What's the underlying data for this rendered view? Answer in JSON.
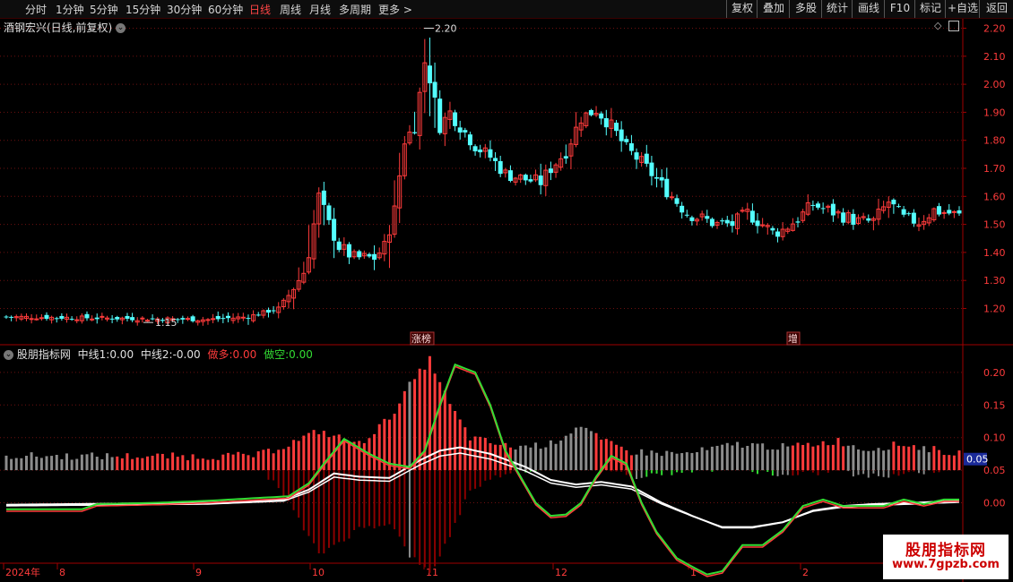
{
  "toolbar": {
    "periods": [
      "分时",
      "1分钟",
      "5分钟",
      "15分钟",
      "30分钟",
      "60分钟",
      "日线",
      "周线",
      "月线",
      "多周期",
      "更多"
    ],
    "active_period": "日线",
    "more_arrow": ">",
    "right_buttons": [
      "复权",
      "叠加",
      "多股",
      "统计",
      "画线",
      "F10",
      "标记",
      "+自选",
      "返回"
    ]
  },
  "main_panel": {
    "title": "酒钢宏兴(日线,前复权)",
    "max_label": "2.20",
    "min_label": "1.15",
    "events": [
      "涨榜",
      "增"
    ]
  },
  "indicator_panel": {
    "name": "股朋指标网",
    "mid1_label": "中线1:",
    "mid1_value": "0.00",
    "mid2_label": "中线2:",
    "mid2_value": "-0.00",
    "long_label": "做多:",
    "long_value": "0.00",
    "short_label": "做空:",
    "short_value": "0.00",
    "current_value": "0.05"
  },
  "price_axis": [
    "2.20",
    "2.10",
    "2.00",
    "1.90",
    "1.80",
    "1.70",
    "1.60",
    "1.50",
    "1.40",
    "1.30",
    "1.20"
  ],
  "indicator_axis": [
    "0.20",
    "0.15",
    "0.10",
    "0.05",
    "0.00"
  ],
  "time_axis": [
    "2024年",
    "8",
    "9",
    "10",
    "11",
    "12",
    "1",
    "2"
  ],
  "watermark": {
    "title": "股朋指标网",
    "url": "www.7gpzb.com"
  },
  "colors": {
    "up": "#ff3b3b",
    "down": "#54ffff",
    "white": "#ffffff",
    "green": "#33dd33",
    "gray": "#8c8c8c",
    "darkred": "#8b0000",
    "grid": "#6e1010"
  },
  "chart_data": {
    "type": "candlestick",
    "ylim": [
      1.12,
      2.25
    ],
    "price_waypoints": [
      [
        0,
        1.17
      ],
      [
        40,
        1.16
      ],
      [
        48,
        1.17
      ],
      [
        50,
        1.18
      ],
      [
        54,
        1.2
      ],
      [
        57,
        1.27
      ],
      [
        59,
        1.33
      ],
      [
        60,
        1.4
      ],
      [
        62,
        1.6
      ],
      [
        64,
        1.5
      ],
      [
        66,
        1.42
      ],
      [
        69,
        1.38
      ],
      [
        73,
        1.38
      ],
      [
        75,
        1.42
      ],
      [
        77,
        1.55
      ],
      [
        79,
        1.8
      ],
      [
        81,
        1.85
      ],
      [
        83,
        2.08
      ],
      [
        84,
        2.02
      ],
      [
        86,
        1.85
      ],
      [
        88,
        1.9
      ],
      [
        90,
        1.85
      ],
      [
        93,
        1.78
      ],
      [
        96,
        1.74
      ],
      [
        99,
        1.68
      ],
      [
        103,
        1.66
      ],
      [
        106,
        1.65
      ],
      [
        108,
        1.7
      ],
      [
        111,
        1.76
      ],
      [
        114,
        1.88
      ],
      [
        117,
        1.91
      ],
      [
        120,
        1.85
      ],
      [
        123,
        1.77
      ],
      [
        126,
        1.72
      ],
      [
        129,
        1.66
      ],
      [
        132,
        1.6
      ],
      [
        135,
        1.54
      ],
      [
        138,
        1.52
      ],
      [
        141,
        1.5
      ],
      [
        144,
        1.5
      ],
      [
        147,
        1.54
      ],
      [
        150,
        1.5
      ],
      [
        152,
        1.47
      ],
      [
        154,
        1.48
      ],
      [
        157,
        1.52
      ],
      [
        160,
        1.57
      ],
      [
        163,
        1.55
      ],
      [
        166,
        1.53
      ],
      [
        169,
        1.51
      ],
      [
        172,
        1.51
      ],
      [
        175,
        1.58
      ],
      [
        178,
        1.52
      ],
      [
        181,
        1.51
      ],
      [
        184,
        1.55
      ],
      [
        187,
        1.54
      ],
      [
        189,
        1.53
      ]
    ],
    "white_line": [
      [
        0,
        -0.003
      ],
      [
        40,
        0.0
      ],
      [
        55,
        0.005
      ],
      [
        60,
        0.02
      ],
      [
        65,
        0.045
      ],
      [
        70,
        0.04
      ],
      [
        76,
        0.038
      ],
      [
        82,
        0.065
      ],
      [
        86,
        0.08
      ],
      [
        90,
        0.085
      ],
      [
        96,
        0.075
      ],
      [
        103,
        0.055
      ],
      [
        108,
        0.035
      ],
      [
        113,
        0.028
      ],
      [
        118,
        0.032
      ],
      [
        124,
        0.025
      ],
      [
        130,
        0.0
      ],
      [
        136,
        -0.02
      ],
      [
        142,
        -0.038
      ],
      [
        148,
        -0.038
      ],
      [
        154,
        -0.03
      ],
      [
        160,
        -0.012
      ],
      [
        166,
        -0.005
      ],
      [
        172,
        -0.002
      ],
      [
        180,
        0.0
      ],
      [
        189,
        0.003
      ]
    ],
    "green_line": [
      [
        0,
        -0.01
      ],
      [
        15,
        -0.01
      ],
      [
        18,
        -0.002
      ],
      [
        30,
        0.0
      ],
      [
        40,
        0.003
      ],
      [
        56,
        0.01
      ],
      [
        60,
        0.03
      ],
      [
        63,
        0.06
      ],
      [
        67,
        0.098
      ],
      [
        72,
        0.075
      ],
      [
        76,
        0.06
      ],
      [
        80,
        0.055
      ],
      [
        83,
        0.08
      ],
      [
        86,
        0.15
      ],
      [
        89,
        0.212
      ],
      [
        93,
        0.2
      ],
      [
        96,
        0.15
      ],
      [
        99,
        0.08
      ],
      [
        102,
        0.04
      ],
      [
        105,
        0.0
      ],
      [
        108,
        -0.02
      ],
      [
        111,
        -0.018
      ],
      [
        114,
        0.0
      ],
      [
        117,
        0.04
      ],
      [
        120,
        0.072
      ],
      [
        123,
        0.06
      ],
      [
        126,
        0.0
      ],
      [
        129,
        -0.045
      ],
      [
        133,
        -0.085
      ],
      [
        136,
        -0.098
      ],
      [
        139,
        -0.11
      ],
      [
        142,
        -0.105
      ],
      [
        146,
        -0.065
      ],
      [
        150,
        -0.065
      ],
      [
        154,
        -0.042
      ],
      [
        158,
        -0.005
      ],
      [
        162,
        0.005
      ],
      [
        166,
        -0.005
      ],
      [
        170,
        -0.005
      ],
      [
        174,
        -0.005
      ],
      [
        178,
        0.005
      ],
      [
        182,
        -0.002
      ],
      [
        186,
        0.005
      ],
      [
        189,
        0.005
      ]
    ],
    "hist_above": [
      [
        0,
        0.072
      ],
      [
        40,
        0.071
      ],
      [
        50,
        0.073
      ],
      [
        56,
        0.09
      ],
      [
        62,
        0.11
      ],
      [
        66,
        0.1
      ],
      [
        70,
        0.09
      ],
      [
        76,
        0.13
      ],
      [
        80,
        0.18
      ],
      [
        84,
        0.22
      ],
      [
        88,
        0.15
      ],
      [
        92,
        0.1
      ],
      [
        100,
        0.085
      ],
      [
        108,
        0.09
      ],
      [
        114,
        0.12
      ],
      [
        118,
        0.095
      ],
      [
        124,
        0.078
      ],
      [
        135,
        0.075
      ],
      [
        145,
        0.09
      ],
      [
        155,
        0.085
      ],
      [
        165,
        0.095
      ],
      [
        170,
        0.082
      ],
      [
        178,
        0.09
      ],
      [
        185,
        0.08
      ],
      [
        189,
        0.075
      ]
    ],
    "hist_below": [
      [
        0,
        0.068
      ],
      [
        40,
        0.068
      ],
      [
        50,
        0.06
      ],
      [
        56,
        0.0
      ],
      [
        62,
        -0.08
      ],
      [
        66,
        -0.06
      ],
      [
        70,
        -0.04
      ],
      [
        76,
        -0.03
      ],
      [
        80,
        -0.08
      ],
      [
        84,
        -0.11
      ],
      [
        88,
        -0.05
      ],
      [
        92,
        0.02
      ],
      [
        100,
        0.05
      ],
      [
        108,
        0.052
      ],
      [
        114,
        0.06
      ],
      [
        118,
        0.055
      ],
      [
        124,
        0.04
      ],
      [
        135,
        0.05
      ],
      [
        145,
        0.055
      ],
      [
        155,
        0.04
      ],
      [
        165,
        0.05
      ],
      [
        170,
        0.04
      ],
      [
        178,
        0.045
      ],
      [
        185,
        0.05
      ],
      [
        189,
        0.06
      ]
    ]
  }
}
